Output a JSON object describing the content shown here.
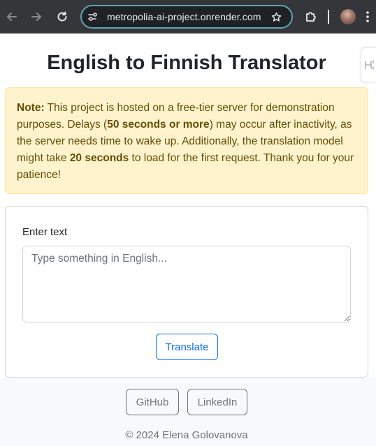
{
  "browser": {
    "url": "metropolia-ai-project.onrender.com"
  },
  "page": {
    "title": "English to Finnish Translator",
    "notice": {
      "label": "Note:",
      "text_1": " This project is hosted on a free-tier server for demonstration purposes. Delays (",
      "bold_1": "50 seconds or more",
      "text_2": ") may occur after inactivity, as the server needs time to wake up. Additionally, the translation model might take ",
      "bold_2": "20 seconds",
      "text_3": " to load for the first request. Thank you for your patience!"
    },
    "form": {
      "label": "Enter text",
      "placeholder": "Type something in English...",
      "value": "",
      "submit_label": "Translate"
    },
    "footer": {
      "github_label": "GitHub",
      "linkedin_label": "LinkedIn",
      "copyright": "© 2024 Elena Golovanova"
    }
  },
  "colors": {
    "alert_bg": "#fff3cd",
    "alert_text": "#664d03",
    "primary": "#0d6efd",
    "secondary": "#6c757d",
    "chrome_bg": "#35363a",
    "omnibox_ring": "#5fa5b4"
  }
}
